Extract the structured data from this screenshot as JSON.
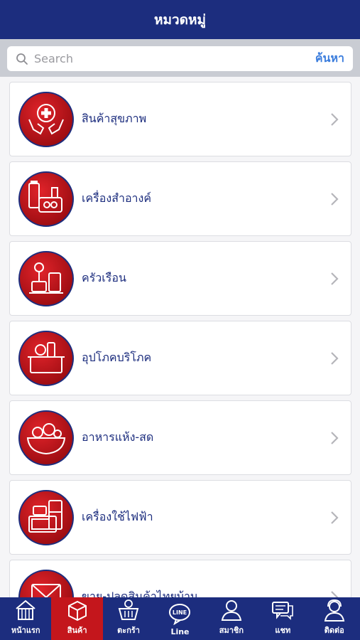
{
  "header": {
    "title": "หมวดหมู่"
  },
  "search": {
    "placeholder": "Search",
    "button_label": "ค้นหา",
    "value": ""
  },
  "categories": [
    {
      "label": "สินค้าสุขภาพ",
      "icon": "health-hands-icon"
    },
    {
      "label": "เครื่องสำอางค์",
      "icon": "cosmetics-icon"
    },
    {
      "label": "ครัวเรือน",
      "icon": "household-icon"
    },
    {
      "label": "อุปโภคบริโภค",
      "icon": "consumer-goods-icon"
    },
    {
      "label": "อาหารแห้ง-สด",
      "icon": "food-bowl-icon"
    },
    {
      "label": "เครื่องใช้ไฟฟ้า",
      "icon": "appliances-icon"
    },
    {
      "label": "ขาย-ปลดสินค้าไทยบ้าน",
      "icon": "wholesale-box-icon"
    }
  ],
  "tabs": [
    {
      "label": "หน้าแรก",
      "icon": "home-icon",
      "active": false
    },
    {
      "label": "สินค้า",
      "icon": "products-box-icon",
      "active": true
    },
    {
      "label": "ตะกร้า",
      "icon": "basket-icon",
      "active": false
    },
    {
      "label": "Line",
      "icon": "line-chat-icon",
      "active": false
    },
    {
      "label": "สมาชิก",
      "icon": "member-icon",
      "active": false
    },
    {
      "label": "แชท",
      "icon": "chat-icon",
      "active": false
    },
    {
      "label": "ติดต่อ",
      "icon": "contact-icon",
      "active": false
    }
  ],
  "colors": {
    "brand_blue": "#1c2d7e",
    "accent_red": "#c4161c",
    "link_blue": "#3b7ddd"
  }
}
